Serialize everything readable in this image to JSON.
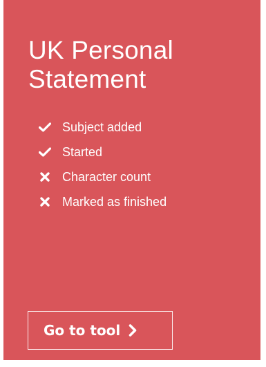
{
  "card": {
    "title": "UK Personal Statement",
    "background_color": "#d9555a",
    "checklist": [
      {
        "label": "Subject added",
        "status": "done",
        "icon": "check-icon"
      },
      {
        "label": "Started",
        "status": "done",
        "icon": "check-icon"
      },
      {
        "label": "Character count",
        "status": "not-done",
        "icon": "cross-icon"
      },
      {
        "label": "Marked as finished",
        "status": "not-done",
        "icon": "cross-icon"
      }
    ],
    "button_label": "Go to tool",
    "button_icon": "chevron-right-icon"
  }
}
